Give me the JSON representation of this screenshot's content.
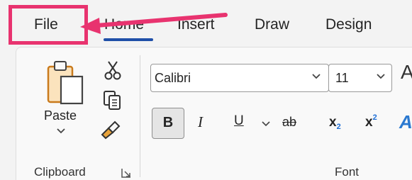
{
  "tabs": {
    "file": "File",
    "home": "Home",
    "insert": "Insert",
    "draw": "Draw",
    "design": "Design"
  },
  "clipboard": {
    "paste_label": "Paste",
    "group_label": "Clipboard"
  },
  "font": {
    "font_name": "Calibri",
    "font_size": "11",
    "grow_glyph": "A",
    "bold": "B",
    "italic": "I",
    "underline": "U",
    "strikethrough": "ab",
    "subscript_base": "x",
    "subscript_digit": "2",
    "superscript_base": "x",
    "superscript_digit": "2",
    "text_effects_glyph": "A",
    "group_label": "Font"
  },
  "icons": {
    "paste": "clipboard-paste-icon",
    "cut": "scissors-icon",
    "copy": "copy-icon",
    "format_painter": "paintbrush-icon",
    "dialog_launcher": "dialog-launcher-icon",
    "dropdown": "chevron-down-icon"
  },
  "colors": {
    "annotation": "#e8336f",
    "active_tab_underline": "#1f4fa8",
    "format_painter_accent": "#e8a33b",
    "subscript_accent": "#1f6fd6"
  }
}
